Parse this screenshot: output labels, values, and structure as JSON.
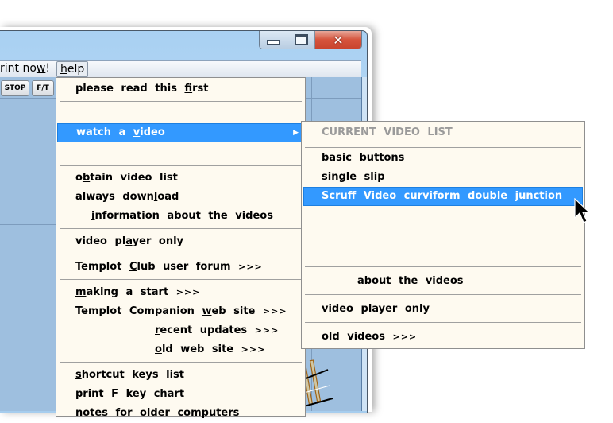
{
  "window": {
    "caption_buttons": {
      "minimize": "minimize-icon",
      "maximize": "maximize-icon",
      "close": "close-icon"
    }
  },
  "menubar": {
    "print_now": {
      "prefix": "rint no",
      "underline": "w",
      "suffix": "!"
    },
    "help": {
      "underline": "h",
      "rest": "elp"
    }
  },
  "toolbar": {
    "stop_label": "STOP",
    "ft_label": "F/T"
  },
  "help_menu": {
    "items": [
      {
        "id": "please-read",
        "pre": "please  read  this  ",
        "ul": "f",
        "post": "irst"
      },
      {
        "id": "watch-video",
        "pre": "watch  a  ",
        "ul": "v",
        "post": "ideo",
        "submenu_arrow": "▶",
        "highlighted": true
      },
      {
        "id": "obtain-list",
        "pre": "o",
        "ul": "b",
        "post": "tain  video  list"
      },
      {
        "id": "always-download",
        "pre": "always  down",
        "ul": "l",
        "post": "oad"
      },
      {
        "id": "info-videos",
        "pre": "",
        "ul": "i",
        "post": "nformation  about  the  videos"
      },
      {
        "id": "video-player",
        "pre": "video  pl",
        "ul": "a",
        "post": "yer  only"
      },
      {
        "id": "club-forum",
        "pre": "Templot  ",
        "ul": "C",
        "post": "lub  user  forum",
        "more": ">>>"
      },
      {
        "id": "making-start",
        "pre": "",
        "ul": "m",
        "post": "aking  a  start",
        "more": ">>>"
      },
      {
        "id": "companion-site",
        "pre": "Templot  Companion  ",
        "ul": "w",
        "post": "eb  site",
        "more": ">>>"
      },
      {
        "id": "recent-updates",
        "pre": "",
        "ul": "r",
        "post": "ecent  updates",
        "more": ">>>"
      },
      {
        "id": "old-web-site",
        "pre": "",
        "ul": "o",
        "post": "ld  web  site",
        "more": ">>>"
      },
      {
        "id": "shortcut-keys",
        "pre": "",
        "ul": "s",
        "post": "hortcut  keys  list"
      },
      {
        "id": "print-f-key",
        "pre": "print  F  ",
        "ul": "k",
        "post": "ey  chart"
      },
      {
        "id": "notes-older",
        "pre": "notes  for  older  computers",
        "ul": "",
        "post": ""
      }
    ]
  },
  "video_submenu": {
    "header": "CURRENT  VIDEO  LIST",
    "items": [
      {
        "id": "basic-buttons",
        "label": "basic  buttons"
      },
      {
        "id": "single-slip",
        "label": "single  slip"
      },
      {
        "id": "scruff-video",
        "label": "Scruff  Video  curviform  double  junction",
        "highlighted": true
      },
      {
        "id": "about-videos",
        "label": "about  the  videos"
      },
      {
        "id": "video-player-only",
        "label": "video  player  only"
      },
      {
        "id": "old-videos",
        "label": "old  videos",
        "more": ">>>"
      }
    ]
  },
  "colors": {
    "highlight": "#3399ff",
    "menu_bg": "#fefaf0",
    "canvas_bg": "#9ebfdf"
  }
}
